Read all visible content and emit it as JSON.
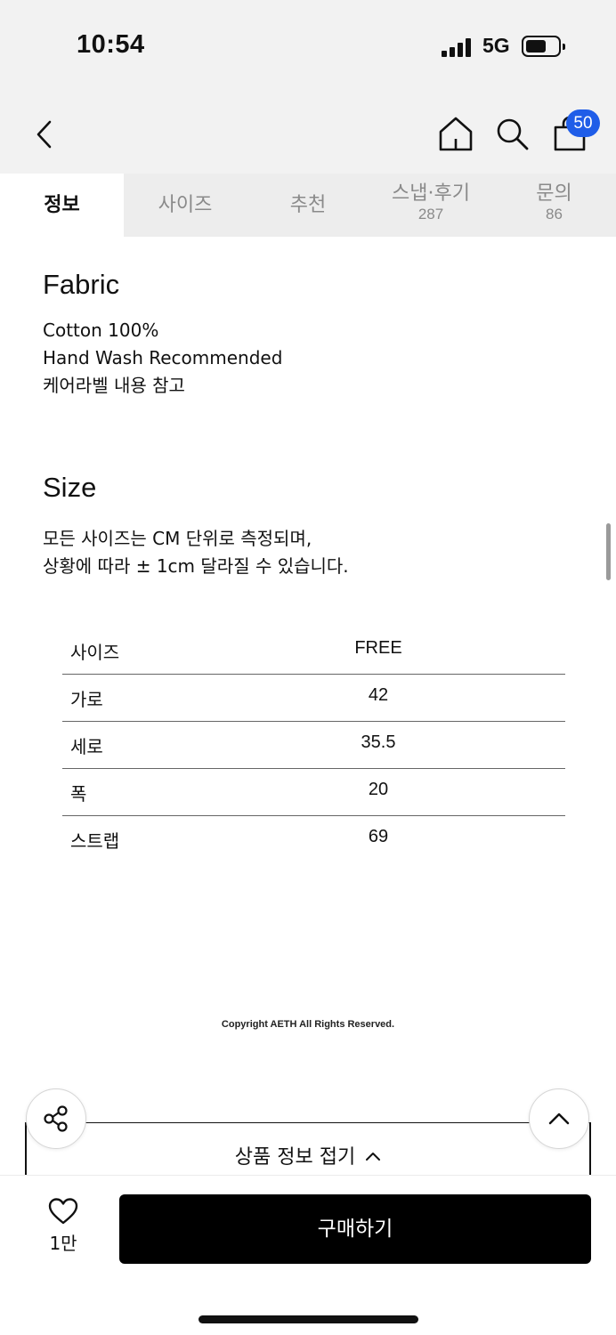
{
  "status_bar": {
    "time": "10:54",
    "network": "5G",
    "icons": [
      "signal-icon",
      "battery-icon"
    ]
  },
  "nav": {
    "icons": [
      "back-icon",
      "home-icon",
      "search-icon",
      "shopping-bag-icon"
    ],
    "cart_count": "50"
  },
  "tabs": [
    {
      "label": "정보",
      "count": "",
      "active": true
    },
    {
      "label": "사이즈",
      "count": ""
    },
    {
      "label": "추천",
      "count": ""
    },
    {
      "label": "스냅·후기",
      "count": "287"
    },
    {
      "label": "문의",
      "count": "86"
    }
  ],
  "fabric": {
    "title": "Fabric",
    "lines": [
      "Cotton 100%",
      "Hand Wash Recommended",
      "케어라벨 내용 참고"
    ]
  },
  "size": {
    "title": "Size",
    "lines": [
      "모든 사이즈는 CM 단위로 측정되며,",
      "상황에 따라 ± 1cm 달라질 수 있습니다."
    ],
    "table": {
      "header": [
        "사이즈",
        "FREE"
      ],
      "rows": [
        [
          "가로",
          "42"
        ],
        [
          "세로",
          "35.5"
        ],
        [
          "폭",
          "20"
        ],
        [
          "스트랩",
          "69"
        ]
      ]
    }
  },
  "copyright": "Copyright AETH All Rights Reserved.",
  "fold": {
    "label": "상품 정보 접기",
    "chevron": "^"
  },
  "action_icons": [
    "share-icon",
    "chevron-up-icon",
    "heart-icon"
  ],
  "bottom": {
    "like_count": "1만",
    "buy_label": "구매하기"
  },
  "colors": {
    "badge": "#1f5de8",
    "buy_button": "#000000",
    "header_bg": "#f2f2f2"
  }
}
